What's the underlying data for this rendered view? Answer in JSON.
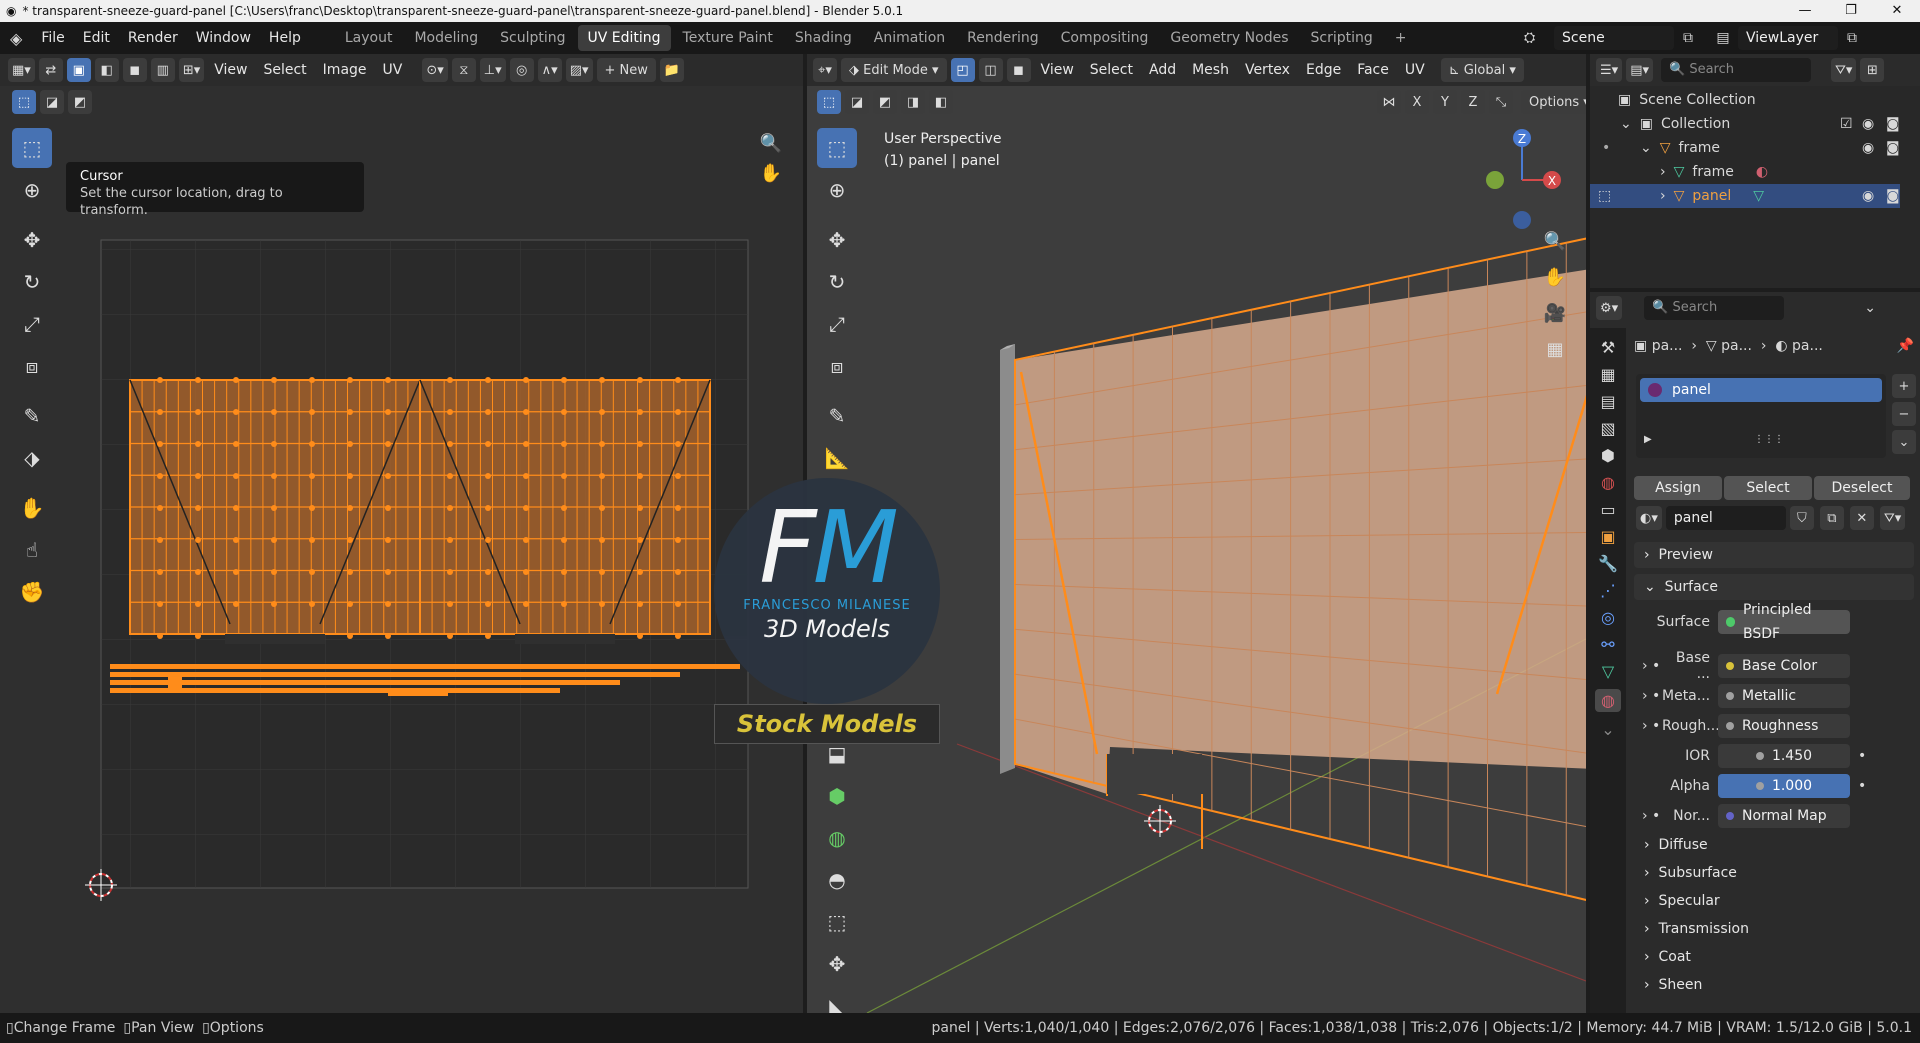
{
  "titlebar": {
    "text": "* transparent-sneeze-guard-panel [C:\\Users\\franc\\Desktop\\transparent-sneeze-guard-panel\\transparent-sneeze-guard-panel.blend] - Blender 5.0.1",
    "min": "—",
    "max": "❐",
    "close": "✕"
  },
  "menu": [
    "File",
    "Edit",
    "Render",
    "Window",
    "Help"
  ],
  "workspaces": [
    "Layout",
    "Modeling",
    "Sculpting",
    "UV Editing",
    "Texture Paint",
    "Shading",
    "Animation",
    "Rendering",
    "Compositing",
    "Geometry Nodes",
    "Scripting"
  ],
  "active_workspace": "UV Editing",
  "add_workspace": "+",
  "scene": {
    "label": "Scene",
    "viewlayer": "ViewLayer"
  },
  "uv_editor": {
    "menus": [
      "View",
      "Select",
      "Image",
      "UV"
    ],
    "new_label": "New",
    "tooltip_title": "Cursor",
    "tooltip_desc": "Set the cursor location, drag to transform."
  },
  "viewport": {
    "mode": "Edit Mode",
    "menus": [
      "View",
      "Select",
      "Add",
      "Mesh",
      "Vertex",
      "Edge",
      "Face",
      "UV"
    ],
    "transform": "Global",
    "options": "Options",
    "axes_x": "X",
    "axes_y": "Y",
    "axes_z": "Z",
    "info1": "User Perspective",
    "info2": "(1) panel | panel",
    "gizmo_z": "Z",
    "gizmo_x": "X"
  },
  "watermark": {
    "initials_f": "F",
    "initials_m": "M",
    "name": "FRANCESCO MILANESE",
    "sub": "3D Models",
    "banner": "Stock Models"
  },
  "outliner": {
    "search": "Search",
    "rows": [
      {
        "label": "Scene Collection"
      },
      {
        "label": "Collection"
      },
      {
        "label": "frame"
      },
      {
        "label": "frame"
      },
      {
        "label": "panel"
      }
    ]
  },
  "properties": {
    "search": "Search",
    "breadcrumb": [
      "pa...",
      "pa...",
      "pa..."
    ],
    "slot": "panel",
    "assign": "Assign",
    "select": "Select",
    "deselect": "Deselect",
    "material": "panel",
    "sections": {
      "preview": "Preview",
      "surface": "Surface"
    },
    "surface_label": "Surface",
    "surface_value": "Principled BSDF",
    "inputs": [
      {
        "label": "Base ...",
        "value": "Base Color",
        "color": "#d8c23a",
        "blue": false
      },
      {
        "label": "Meta...",
        "value": "Metallic",
        "color": "#a0a0a0",
        "blue": false
      },
      {
        "label": "Rough...",
        "value": "Roughness",
        "color": "#a0a0a0",
        "blue": false
      },
      {
        "label": "IOR",
        "value": "1.450",
        "color": "#a0a0a0",
        "blue": false
      },
      {
        "label": "Alpha",
        "value": "1.000",
        "color": "#a0a0a0",
        "blue": true
      },
      {
        "label": "Nor...",
        "value": "Normal Map",
        "color": "#6363c7",
        "blue": false
      }
    ],
    "subsections": [
      "Diffuse",
      "Subsurface",
      "Specular",
      "Transmission",
      "Coat",
      "Sheen"
    ]
  },
  "status": {
    "left": [
      "Change Frame",
      "Pan View",
      "Options"
    ],
    "stats": "panel | Verts:1,040/1,040 | Edges:2,076/2,076 | Faces:1,038/1,038 | Tris:2,076 | Objects:1/2 | Memory: 44.7 MiB | VRAM: 1.5/12.0 GiB | 5.0.1"
  },
  "colors": {
    "accent": "#4772b3",
    "mesh": "#ff8c1a",
    "selected_row": "#334d80"
  }
}
